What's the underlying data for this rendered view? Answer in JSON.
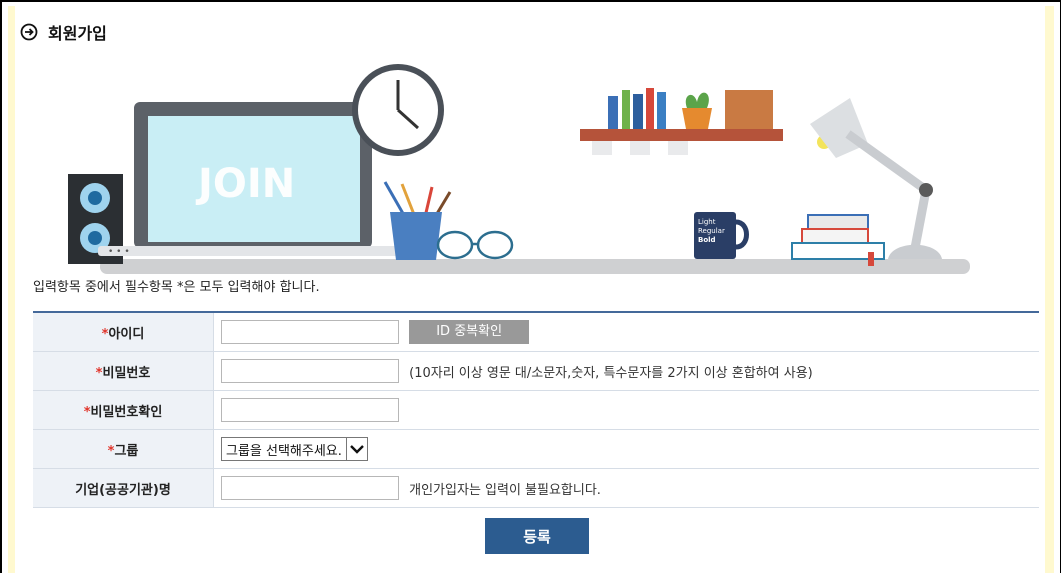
{
  "page": {
    "title": "회원가입"
  },
  "banner": {
    "join_text": "JOIN",
    "mug_text": [
      "Light",
      "Regular",
      "Bold"
    ]
  },
  "notice": "입력항목 중에서 필수항목 *은 모두 입력해야 합니다.",
  "form": {
    "required_mark": "*",
    "id_label": "아이디",
    "id_check_button": "ID 중복확인",
    "password_label": "비밀번호",
    "password_hint": "(10자리 이상 영문 대/소문자,숫자, 특수문자를 2가지 이상 혼합하여 사용)",
    "password_confirm_label": "비밀번호확인",
    "group_label": "그룹",
    "group_selected": "그룹을 선택해주세요.",
    "company_label": "기업(공공기관)명",
    "company_hint": "개인가입자는 입력이 불필요합니다.",
    "submit_button": "등록"
  },
  "colors": {
    "accent": "#2c5c90",
    "required": "#e0352b",
    "frame_background": "#fff9cf",
    "label_background": "#eef2f7"
  }
}
